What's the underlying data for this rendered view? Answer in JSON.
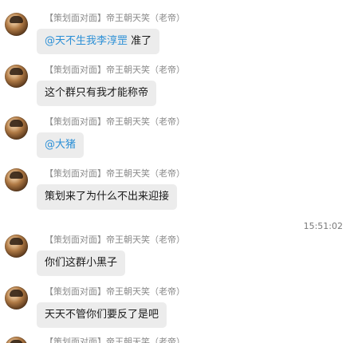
{
  "messages": [
    {
      "sender": "【策划面对面】帝王朝天笑（老帝）",
      "mention": "@天不生我李淳罡",
      "text": " 准了"
    },
    {
      "sender": "【策划面对面】帝王朝天笑（老帝）",
      "mention": "",
      "text": "这个群只有我才能称帝"
    },
    {
      "sender": "【策划面对面】帝王朝天笑（老帝）",
      "mention": "@大猪",
      "text": ""
    },
    {
      "sender": "【策划面对面】帝王朝天笑（老帝）",
      "mention": "",
      "text": "策划来了为什么不出来迎接"
    },
    {
      "sender": "【策划面对面】帝王朝天笑（老帝）",
      "mention": "",
      "text": "你们这群小黑子"
    },
    {
      "sender": "【策划面对面】帝王朝天笑（老帝）",
      "mention": "",
      "text": "天天不管你们要反了是吧"
    },
    {
      "sender": "【策划面对面】帝王朝天笑（老帝）",
      "mention": "",
      "text": ""
    }
  ],
  "timestamp": "15:51:02",
  "colors": {
    "bubble": "#ececec",
    "mention": "#2b8fd6",
    "sender": "#8a8a8a"
  },
  "icons": {
    "avatar": "user-avatar"
  }
}
